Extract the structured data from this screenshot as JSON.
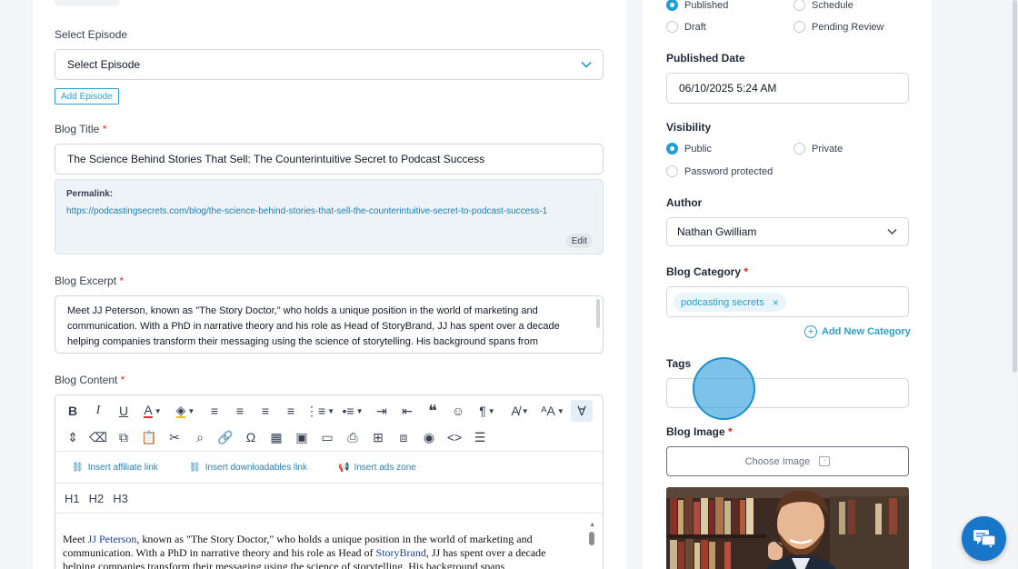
{
  "left": {
    "select_episode_label": "Select Episode",
    "select_episode_value": "Select Episode",
    "add_episode_button": "Add Episode",
    "blog_title_label": "Blog Title",
    "required_mark": "*",
    "blog_title_value": "The Science Behind Stories That Sell: The Counterintuitive Secret to Podcast Success",
    "permalink_label": "Permalink:",
    "permalink_url": "https://podcastingsecrets.com/blog/the-science-behind-stories-that-sell-the-counterintuitive-secret-to-podcast-success-1",
    "edit_button": "Edit",
    "blog_excerpt_label": "Blog Excerpt",
    "blog_excerpt_value": "Meet JJ Peterson, known as \"The Story Doctor,\" who holds a unique position in the world of marketing and communication. With a PhD in narrative theory and his role as Head of StoryBrand, JJ has spent over a decade helping companies transform their messaging using the science of storytelling. His background spans from Hollywood films to churches and businesses like The Office and The West Wing to commercial work.",
    "blog_content_label": "Blog Content"
  },
  "editor": {
    "insert_affiliate": "Insert affiliate link",
    "insert_downloadables": "Insert downloadables link",
    "insert_ads": "Insert ads zone",
    "headings": [
      "H1",
      "H2",
      "H3"
    ],
    "content_1": "Meet ",
    "content_link_1": "JJ Peterson",
    "content_2": ", known as \"The Story Doctor,\" who holds a unique position in the world of marketing and communication. With a PhD in narrative theory and his role as Head of ",
    "content_link_2": "StoryBrand",
    "content_3": ", JJ has spent over a decade helping companies transform their messaging using the science of storytelling. His background spans"
  },
  "right": {
    "status_published": "Published",
    "status_schedule": "Schedule",
    "status_draft": "Draft",
    "status_pending": "Pending Review",
    "published_date_label": "Published Date",
    "published_date_value": "06/10/2025 5:24 AM",
    "visibility_label": "Visibility",
    "vis_public": "Public",
    "vis_private": "Private",
    "vis_password": "Password protected",
    "author_label": "Author",
    "author_value": "Nathan Gwilliam",
    "category_label": "Blog Category",
    "category_chip": "podcasting secrets",
    "add_category": "Add New Category",
    "tags_label": "Tags",
    "blog_image_label": "Blog Image",
    "choose_image": "Choose Image"
  },
  "icons": {
    "chevron": "chevron-down-icon",
    "chat": "chat-icon"
  },
  "colors": {
    "accent": "#2aa1d4",
    "radio_on": "#1f9fd6",
    "link": "#1e7fb5",
    "chat": "#1877c8"
  }
}
